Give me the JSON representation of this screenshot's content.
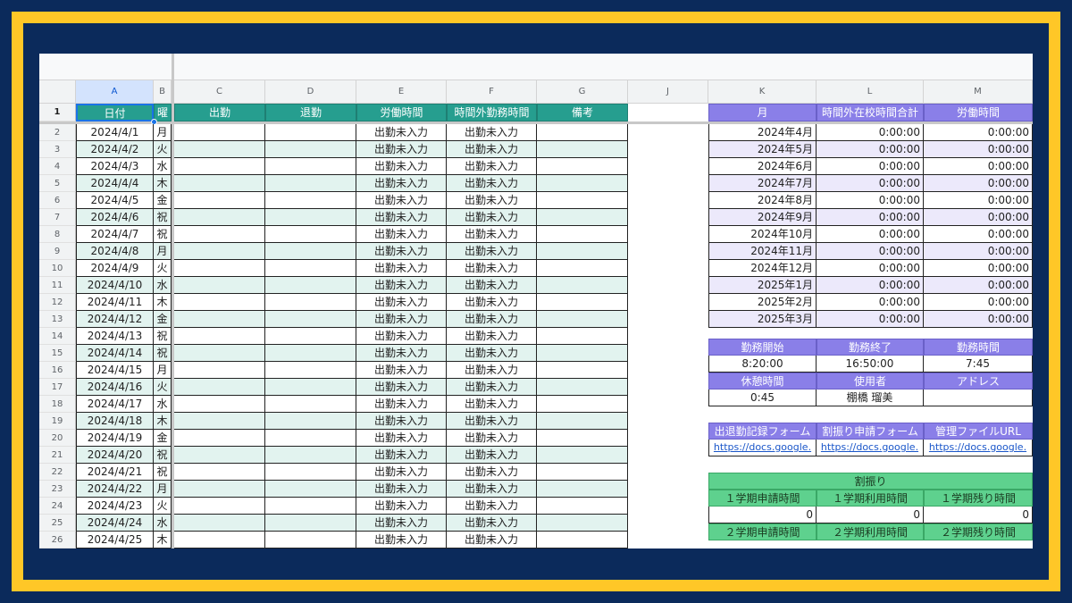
{
  "columns": {
    "corner": "",
    "A": "A",
    "B": "B",
    "C": "C",
    "D": "D",
    "E": "E",
    "F": "F",
    "G": "G",
    "J": "J",
    "K": "K",
    "L": "L",
    "M": "M"
  },
  "headers": {
    "row_num": "1",
    "date": "日付",
    "weekday": "曜",
    "clock_in": "出勤",
    "clock_out": "退勤",
    "work_hours": "労働時間",
    "overtime": "時間外勤務時間",
    "notes": "備考",
    "month": "月",
    "total_overtime": "時間外在校時間合計",
    "labor_hours": "労働時間"
  },
  "rows": [
    {
      "n": "2",
      "date": "2024/4/1",
      "wd": "月",
      "e": "出勤未入力",
      "f": "出勤未入力"
    },
    {
      "n": "3",
      "date": "2024/4/2",
      "wd": "火",
      "e": "出勤未入力",
      "f": "出勤未入力"
    },
    {
      "n": "4",
      "date": "2024/4/3",
      "wd": "水",
      "e": "出勤未入力",
      "f": "出勤未入力"
    },
    {
      "n": "5",
      "date": "2024/4/4",
      "wd": "木",
      "e": "出勤未入力",
      "f": "出勤未入力"
    },
    {
      "n": "6",
      "date": "2024/4/5",
      "wd": "金",
      "e": "出勤未入力",
      "f": "出勤未入力"
    },
    {
      "n": "7",
      "date": "2024/4/6",
      "wd": "祝",
      "e": "出勤未入力",
      "f": "出勤未入力"
    },
    {
      "n": "8",
      "date": "2024/4/7",
      "wd": "祝",
      "e": "出勤未入力",
      "f": "出勤未入力"
    },
    {
      "n": "9",
      "date": "2024/4/8",
      "wd": "月",
      "e": "出勤未入力",
      "f": "出勤未入力"
    },
    {
      "n": "10",
      "date": "2024/4/9",
      "wd": "火",
      "e": "出勤未入力",
      "f": "出勤未入力"
    },
    {
      "n": "11",
      "date": "2024/4/10",
      "wd": "水",
      "e": "出勤未入力",
      "f": "出勤未入力"
    },
    {
      "n": "12",
      "date": "2024/4/11",
      "wd": "木",
      "e": "出勤未入力",
      "f": "出勤未入力"
    },
    {
      "n": "13",
      "date": "2024/4/12",
      "wd": "金",
      "e": "出勤未入力",
      "f": "出勤未入力"
    },
    {
      "n": "14",
      "date": "2024/4/13",
      "wd": "祝",
      "e": "出勤未入力",
      "f": "出勤未入力"
    },
    {
      "n": "15",
      "date": "2024/4/14",
      "wd": "祝",
      "e": "出勤未入力",
      "f": "出勤未入力"
    },
    {
      "n": "16",
      "date": "2024/4/15",
      "wd": "月",
      "e": "出勤未入力",
      "f": "出勤未入力"
    },
    {
      "n": "17",
      "date": "2024/4/16",
      "wd": "火",
      "e": "出勤未入力",
      "f": "出勤未入力"
    },
    {
      "n": "18",
      "date": "2024/4/17",
      "wd": "水",
      "e": "出勤未入力",
      "f": "出勤未入力"
    },
    {
      "n": "19",
      "date": "2024/4/18",
      "wd": "木",
      "e": "出勤未入力",
      "f": "出勤未入力"
    },
    {
      "n": "20",
      "date": "2024/4/19",
      "wd": "金",
      "e": "出勤未入力",
      "f": "出勤未入力"
    },
    {
      "n": "21",
      "date": "2024/4/20",
      "wd": "祝",
      "e": "出勤未入力",
      "f": "出勤未入力"
    },
    {
      "n": "22",
      "date": "2024/4/21",
      "wd": "祝",
      "e": "出勤未入力",
      "f": "出勤未入力"
    },
    {
      "n": "23",
      "date": "2024/4/22",
      "wd": "月",
      "e": "出勤未入力",
      "f": "出勤未入力"
    },
    {
      "n": "24",
      "date": "2024/4/23",
      "wd": "火",
      "e": "出勤未入力",
      "f": "出勤未入力"
    },
    {
      "n": "25",
      "date": "2024/4/24",
      "wd": "水",
      "e": "出勤未入力",
      "f": "出勤未入力"
    },
    {
      "n": "26",
      "date": "2024/4/25",
      "wd": "木",
      "e": "出勤未入力",
      "f": "出勤未入力"
    }
  ],
  "monthly": [
    {
      "month": "2024年4月",
      "overtime": "0:00:00",
      "labor": "0:00:00"
    },
    {
      "month": "2024年5月",
      "overtime": "0:00:00",
      "labor": "0:00:00"
    },
    {
      "month": "2024年6月",
      "overtime": "0:00:00",
      "labor": "0:00:00"
    },
    {
      "month": "2024年7月",
      "overtime": "0:00:00",
      "labor": "0:00:00"
    },
    {
      "month": "2024年8月",
      "overtime": "0:00:00",
      "labor": "0:00:00"
    },
    {
      "month": "2024年9月",
      "overtime": "0:00:00",
      "labor": "0:00:00"
    },
    {
      "month": "2024年10月",
      "overtime": "0:00:00",
      "labor": "0:00:00"
    },
    {
      "month": "2024年11月",
      "overtime": "0:00:00",
      "labor": "0:00:00"
    },
    {
      "month": "2024年12月",
      "overtime": "0:00:00",
      "labor": "0:00:00"
    },
    {
      "month": "2025年1月",
      "overtime": "0:00:00",
      "labor": "0:00:00"
    },
    {
      "month": "2025年2月",
      "overtime": "0:00:00",
      "labor": "0:00:00"
    },
    {
      "month": "2025年3月",
      "overtime": "0:00:00",
      "labor": "0:00:00"
    }
  ],
  "settings": {
    "start_label": "勤務開始",
    "end_label": "勤務終了",
    "duration_label": "勤務時間",
    "start": "8:20:00",
    "end": "16:50:00",
    "duration": "7:45",
    "break_label": "休憩時間",
    "user_label": "使用者",
    "address_label": "アドレス",
    "break": "0:45",
    "user": "棚橋 瑠美",
    "address": ""
  },
  "links": {
    "attendance_label": "出退勤記録フォーム",
    "substitute_label": "割振り申請フォーム",
    "admin_label": "管理ファイルURL",
    "attendance_url": "https://docs.google.",
    "substitute_url": "https://docs.google.",
    "admin_url": "https://docs.google."
  },
  "allocation": {
    "title": "割振り",
    "t1_applied_label": "１学期申請時間",
    "t1_used_label": "１学期利用時間",
    "t1_remaining_label": "１学期残り時間",
    "t1_applied": "0",
    "t1_used": "0",
    "t1_remaining": "0",
    "t2_applied_label": "２学期申請時間",
    "t2_used_label": "２学期利用時間",
    "t2_remaining_label": "２学期残り時間"
  },
  "colors": {
    "border": "#ffc727",
    "background": "#0b2a5b",
    "teal_header": "#269e8f",
    "purple_header": "#8a7fe8",
    "green_header": "#5ed18e"
  }
}
